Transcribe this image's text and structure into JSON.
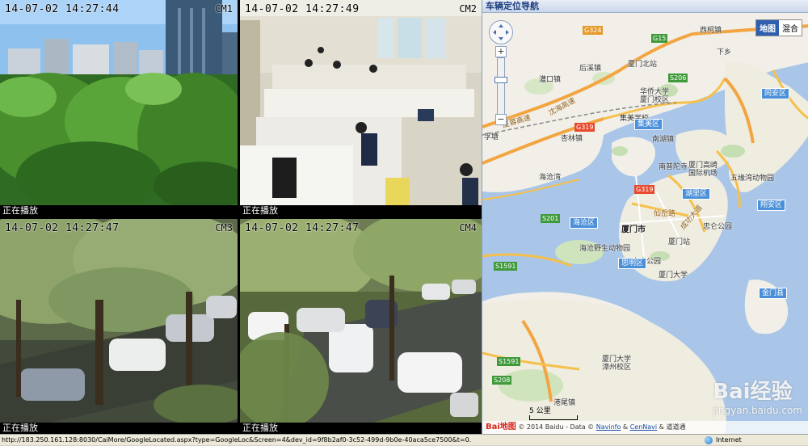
{
  "cameras": [
    {
      "timestamp": "14-07-02 14:27:44",
      "id": "CM1",
      "status": "正在播放"
    },
    {
      "timestamp": "14-07-02 14:27:49",
      "id": "CM2",
      "status": "正在播放"
    },
    {
      "timestamp": "14-07-02 14:27:47",
      "id": "CM3",
      "status": "正在播放"
    },
    {
      "timestamp": "14-07-02 14:27:47",
      "id": "CM4",
      "status": "正在播放"
    }
  ],
  "map": {
    "header_title": "车辆定位导航",
    "map_type_options": [
      "地图",
      "混合"
    ],
    "selected_map_type": "地图",
    "zoom_plus": "+",
    "zoom_minus": "−",
    "scale_label": "5 公里",
    "copyright_logo": "Bai地图",
    "copyright_text": "© 2014 Baidu - Data ©",
    "copyright_link1": "Navinfo",
    "copyright_amp": "&",
    "copyright_link2": "CenNavi",
    "copyright_tail": "& 道道通",
    "watermark": "Bai经验",
    "watermark_sub": "jingyan.baidu.com",
    "labels": {
      "xibin": "西柯镇",
      "xiangshan": "下乡",
      "houxi": "后溪镇",
      "guankou": "灌口镇",
      "xiamen_north": "厦门北站",
      "huaqiao": "华侨大学\n厦门校区",
      "xinglin": "杏林镇",
      "jimei_badge": "集美区",
      "haicang_badge": "海沧区",
      "siming_badge": "思明区",
      "huli_badge": "湖里区",
      "xiangan_badge": "翔安区",
      "tongan_badge": "同安区",
      "xiamen_city": "厦门市",
      "airport": "厦门高崎\n国际机场",
      "wuyuan": "五缘湾动物园",
      "zhongshan": "中山公园",
      "xiamen_station": "厦门站",
      "zhongshan_park": "忠仑公园",
      "xmu": "厦门大学",
      "haicang_park": "海沧野生动物园",
      "nanputuo": "南普陀寺",
      "kinmen": "金门县",
      "xmu_zhangzhou": "厦门大学\n漳州校区",
      "gangwei": "港尾镇",
      "huanlian": "海沧湾",
      "yunqi": "孚塘",
      "jimei_school": "集美学校",
      "nanhu": "南湖镇"
    },
    "road_labels": {
      "g324": "G324",
      "g15": "G15",
      "s206": "S206",
      "g319_a": "G319",
      "g319_b": "G319",
      "s201": "S201",
      "s1591_a": "S1591",
      "s1591_b": "S1591",
      "s208": "S208",
      "shenhai": "沈海高速",
      "xiaxia": "厦蓉高速",
      "xianyue": "仙岳路",
      "chenggong": "成功大道",
      "xiamen_bridge": "厦门大桥"
    }
  },
  "statusbar": {
    "url": "http://183.250.161.128:8030/CaiMore/GoogleLocated.aspx?type=GoogleLoc&Screen=4&dev_id=9f8b2af0-3c52-499d-9b0e-40aca5ce7500&t=0.",
    "zone": "Internet"
  }
}
